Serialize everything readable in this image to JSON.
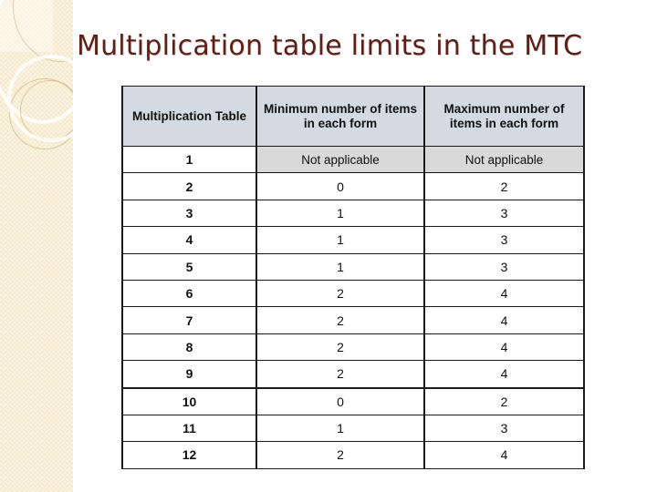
{
  "slide": {
    "title": "Multiplication table limits in the MTC",
    "title_color": "#5c2018",
    "background_color": "#ffffff"
  },
  "sidebar": {
    "name": "decorative-band",
    "base_color": "#f6e8c8",
    "accent_color": "#c6a060"
  },
  "table": {
    "header_background": "#d3dae2",
    "shaded_cell_background": "#d9d9d9",
    "border_color": "#1a1a1a",
    "columns": [
      "Multiplication Table",
      "Minimum number of items in each form",
      "Maximum number of items in each form"
    ],
    "rows": [
      {
        "table": "1",
        "min": "Not applicable",
        "max": "Not applicable",
        "shaded": true
      },
      {
        "table": "2",
        "min": "0",
        "max": "2",
        "shaded": false
      },
      {
        "table": "3",
        "min": "1",
        "max": "3",
        "shaded": false
      },
      {
        "table": "4",
        "min": "1",
        "max": "3",
        "shaded": false
      },
      {
        "table": "5",
        "min": "1",
        "max": "3",
        "shaded": false
      },
      {
        "table": "6",
        "min": "2",
        "max": "4",
        "shaded": false
      },
      {
        "table": "7",
        "min": "2",
        "max": "4",
        "shaded": false
      },
      {
        "table": "8",
        "min": "2",
        "max": "4",
        "shaded": false
      },
      {
        "table": "9",
        "min": "2",
        "max": "4",
        "shaded": false
      },
      {
        "table": "10",
        "min": "0",
        "max": "2",
        "shaded": false
      },
      {
        "table": "11",
        "min": "1",
        "max": "3",
        "shaded": false
      },
      {
        "table": "12",
        "min": "2",
        "max": "4",
        "shaded": false
      }
    ]
  }
}
